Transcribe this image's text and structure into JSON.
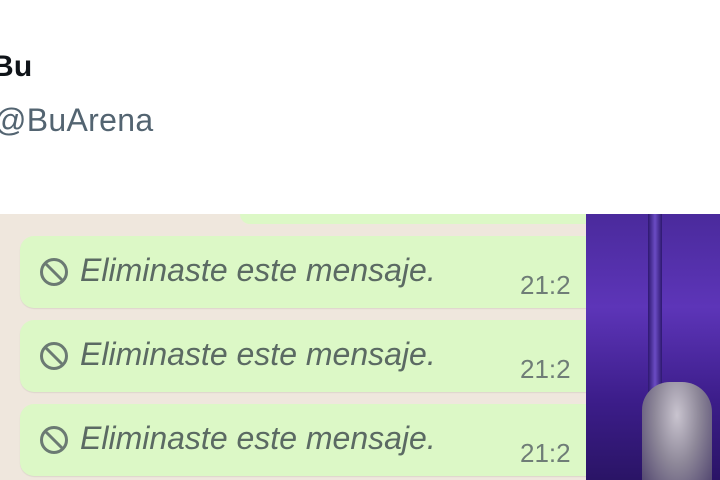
{
  "header": {
    "display_name": "Bu",
    "handle": "@BuArena"
  },
  "chat": {
    "messages": [
      {
        "icon": "ban-icon",
        "text": "Eliminaste este mensaje.",
        "time": "21:2"
      },
      {
        "icon": "ban-icon",
        "text": "Eliminaste este mensaje.",
        "time": "21:2"
      },
      {
        "icon": "ban-icon",
        "text": "Eliminaste este mensaje.",
        "time": "21:2"
      }
    ]
  },
  "colors": {
    "chat_background": "#efe7dd",
    "bubble": "#dcf8c6",
    "deleted_text": "#5b6a63",
    "photo_accent": "#5d35b8"
  }
}
